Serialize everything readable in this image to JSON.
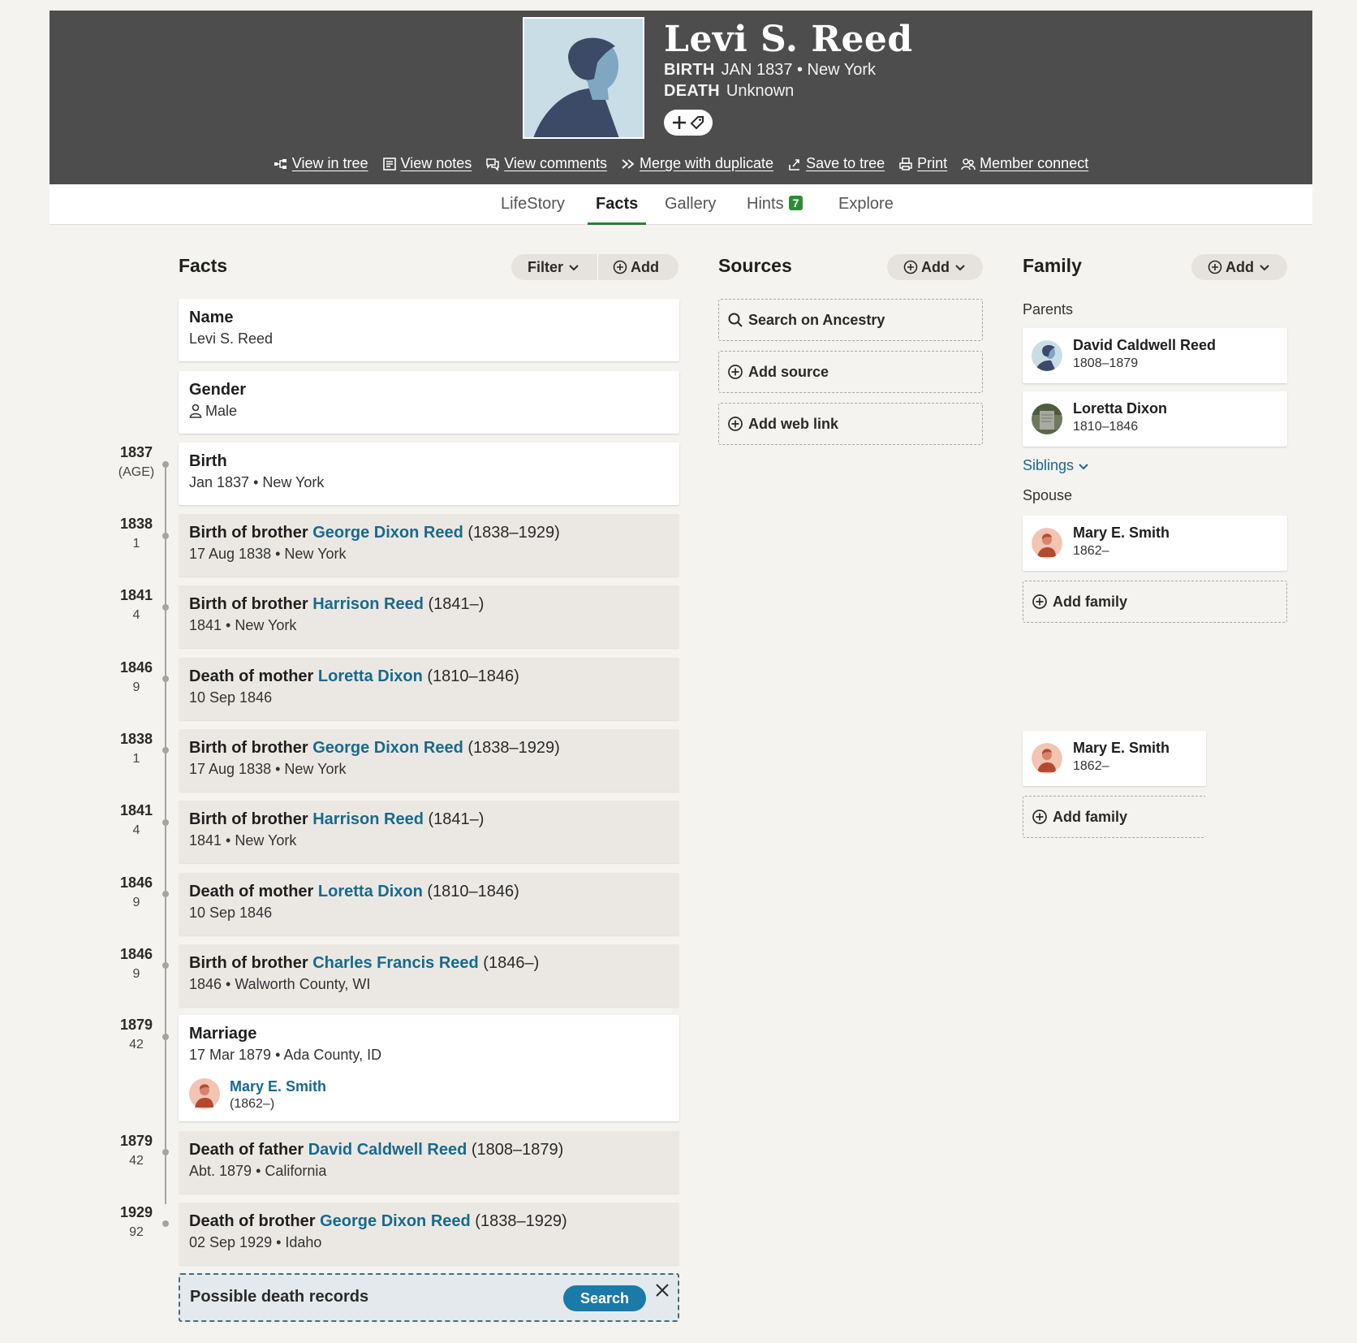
{
  "person": {
    "name": "Levi S. Reed",
    "birth_label": "BIRTH",
    "birth_value": "JAN 1837 • New York",
    "death_label": "DEATH",
    "death_value": "Unknown"
  },
  "actions": [
    {
      "label": "View in tree",
      "icon": "tree-icon"
    },
    {
      "label": "View notes",
      "icon": "notes-icon"
    },
    {
      "label": "View comments",
      "icon": "comments-icon"
    },
    {
      "label": "Merge with duplicate",
      "icon": "merge-icon"
    },
    {
      "label": "Save to tree",
      "icon": "save-icon"
    },
    {
      "label": "Print",
      "icon": "print-icon"
    },
    {
      "label": "Member connect",
      "icon": "members-icon"
    }
  ],
  "tabs": {
    "lifestory": "LifeStory",
    "facts": "Facts",
    "gallery": "Gallery",
    "hints": "Hints",
    "hints_count": "7",
    "explore": "Explore"
  },
  "facts_section": {
    "title": "Facts",
    "filter_label": "Filter",
    "add_label": "Add",
    "name_title": "Name",
    "name_value": "Levi S. Reed",
    "gender_title": "Gender",
    "gender_value": "Male",
    "birth_title": "Birth",
    "birth_value": "Jan 1837 • New York",
    "birth_year": "1837",
    "birth_age": "(AGE)",
    "events": [
      {
        "year": "1838",
        "age": "1",
        "prefix": "Birth of brother ",
        "link": "George Dixon Reed",
        "dates": " (1838–1929)",
        "detail": "17 Aug 1838 • New York"
      },
      {
        "year": "1841",
        "age": "4",
        "prefix": "Birth of brother ",
        "link": "Harrison Reed",
        "dates": " (1841–)",
        "detail": "1841 • New York"
      },
      {
        "year": "1846",
        "age": "9",
        "prefix": "Death of mother ",
        "link": "Loretta Dixon",
        "dates": " (1810–1846)",
        "detail": "10 Sep 1846"
      },
      {
        "year": "1838",
        "age": "1",
        "prefix": "Birth of brother ",
        "link": "George Dixon Reed",
        "dates": " (1838–1929)",
        "detail": "17 Aug 1838 • New York"
      },
      {
        "year": "1841",
        "age": "4",
        "prefix": "Birth of brother ",
        "link": "Harrison Reed",
        "dates": " (1841–)",
        "detail": "1841 • New York"
      },
      {
        "year": "1846",
        "age": "9",
        "prefix": "Death of mother ",
        "link": "Loretta Dixon",
        "dates": " (1810–1846)",
        "detail": "10 Sep 1846"
      },
      {
        "year": "1846",
        "age": "9",
        "prefix": "Birth of brother ",
        "link": "Charles Francis Reed",
        "dates": " (1846–)",
        "detail": "1846 • Walworth County, WI"
      }
    ],
    "marriage": {
      "year": "1879",
      "age": "42",
      "title": "Marriage",
      "detail": "17 Mar 1879 • Ada County, ID",
      "spouse_name": "Mary E. Smith",
      "spouse_years": "(1862–)"
    },
    "late_events": [
      {
        "year": "1879",
        "age": "42",
        "prefix": "Death of father ",
        "link": "David Caldwell Reed",
        "dates": " (1808–1879)",
        "detail": "Abt. 1879 • California"
      },
      {
        "year": "1929",
        "age": "92",
        "prefix": "Death of brother ",
        "link": "George Dixon Reed",
        "dates": " (1838–1929)",
        "detail": "02 Sep 1929 • Idaho"
      }
    ],
    "death_records_label": "Possible death records",
    "death_records_button": "Search"
  },
  "sources_section": {
    "title": "Sources",
    "add_label": "Add",
    "search_label": "Search on Ancestry",
    "add_source_label": "Add source",
    "add_web_link_label": "Add web link"
  },
  "family_section": {
    "title": "Family",
    "add_label": "Add",
    "parents_label": "Parents",
    "father_name": "David Caldwell Reed",
    "father_years": "1808–1879",
    "mother_name": "Loretta Dixon",
    "mother_years": "1810–1846",
    "siblings_label": "Siblings",
    "spouse_label": "Spouse",
    "spouse_name": "Mary E. Smith",
    "spouse_years": "1862–",
    "add_family_label": "Add family",
    "spouse2_name": "Mary E. Smith",
    "spouse2_years": "1862–",
    "add_family2_label": "Add family"
  },
  "colors": {
    "header_bg": "#4d4d4d",
    "link": "#18698c",
    "active_tab": "#2e7d32",
    "search_button": "#1a7aa8"
  }
}
